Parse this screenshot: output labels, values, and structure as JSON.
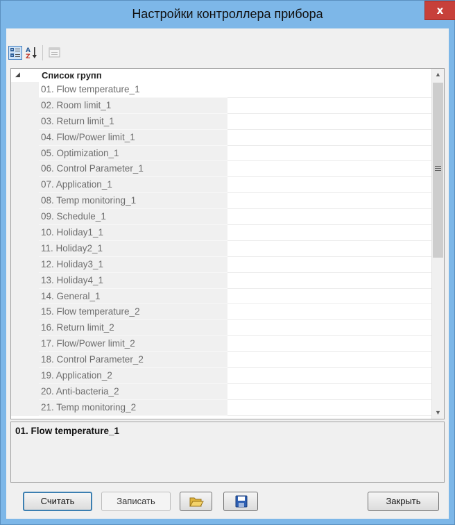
{
  "window": {
    "title": "Настройки контроллера прибора",
    "close_glyph": "x"
  },
  "toolbar": {
    "categorized_icon": "categorized-view-icon",
    "alphabetical_icon": "sort-az-icon",
    "property_pages_icon": "property-pages-icon"
  },
  "grid": {
    "category_label": "Список групп",
    "rows": [
      "01. Flow temperature_1",
      "02. Room limit_1",
      "03. Return limit_1",
      "04. Flow/Power limit_1",
      "05. Optimization_1",
      "06. Control Parameter_1",
      "07. Application_1",
      "08. Temp monitoring_1",
      "09. Schedule_1",
      "10. Holiday1_1",
      "11. Holiday2_1",
      "12. Holiday3_1",
      "13. Holiday4_1",
      "14. General_1",
      "15. Flow temperature_2",
      "16. Return limit_2",
      "17. Flow/Power limit_2",
      "18. Control Parameter_2",
      "19. Application_2",
      "20. Anti-bacteria_2",
      "21. Temp monitoring_2"
    ]
  },
  "help": {
    "title": "01. Flow temperature_1"
  },
  "buttons": {
    "read": "Считать",
    "write": "Записать",
    "open_icon": "open-folder-icon",
    "save_icon": "floppy-disk-icon",
    "close": "Закрыть"
  },
  "colors": {
    "title_bar": "#7db7e8",
    "close_button": "#c7403a",
    "accent": "#3c7fb1"
  }
}
